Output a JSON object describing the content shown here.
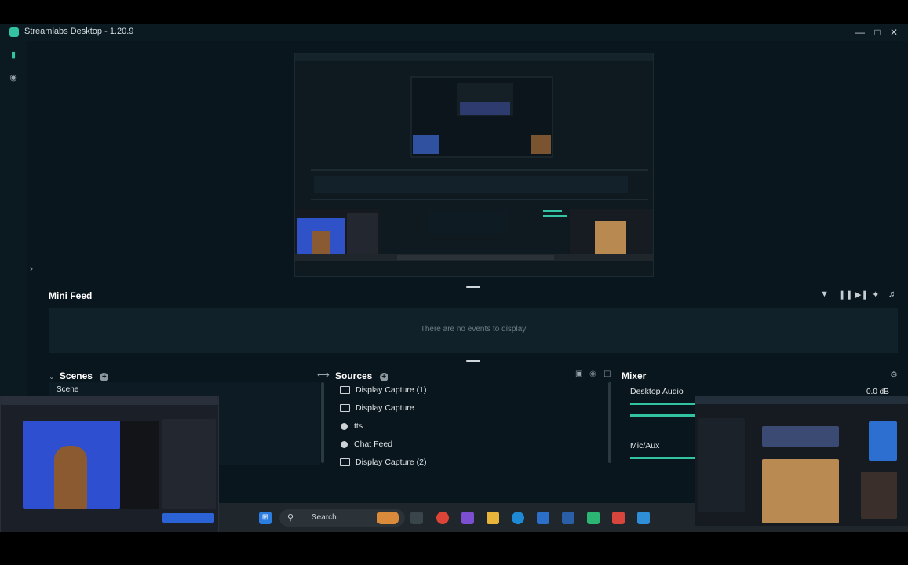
{
  "window": {
    "title": "Streamlabs Desktop - 1.20.9",
    "minimize_icon": "minimize-icon",
    "maximize_icon": "maximize-icon",
    "close_icon": "close-icon"
  },
  "sidebar": {
    "items": [
      {
        "icon": "editor-icon"
      },
      {
        "icon": "play-icon"
      }
    ],
    "collapse_icon": "chevron-right-icon"
  },
  "mini_feed": {
    "title": "Mini Feed",
    "empty_text": "There are no events to display",
    "tools": [
      "filter-icon",
      "pause-icon",
      "skip-icon",
      "mute-alerts-icon",
      "volume-icon"
    ]
  },
  "scenes": {
    "title": "Scenes",
    "items": [
      "Scene"
    ]
  },
  "sources": {
    "title": "Sources",
    "items": [
      {
        "label": "Display Capture (1)",
        "icon": "monitor-icon"
      },
      {
        "label": "Display Capture",
        "icon": "monitor-icon"
      },
      {
        "label": "tts",
        "icon": "globe-icon"
      },
      {
        "label": "Chat Feed",
        "icon": "globe-icon"
      },
      {
        "label": "Display Capture (2)",
        "icon": "monitor-icon"
      }
    ]
  },
  "mixer": {
    "title": "Mixer",
    "channels": [
      {
        "name": "Desktop Audio",
        "db": "0.0 dB",
        "level": 0.28
      },
      {
        "name": "Mic/Aux",
        "db": "",
        "level": 0.28
      }
    ]
  },
  "taskbar": {
    "search_placeholder": "Search"
  },
  "colors": {
    "accent": "#31c3a2",
    "background": "#09161d",
    "panel": "#11212a"
  }
}
